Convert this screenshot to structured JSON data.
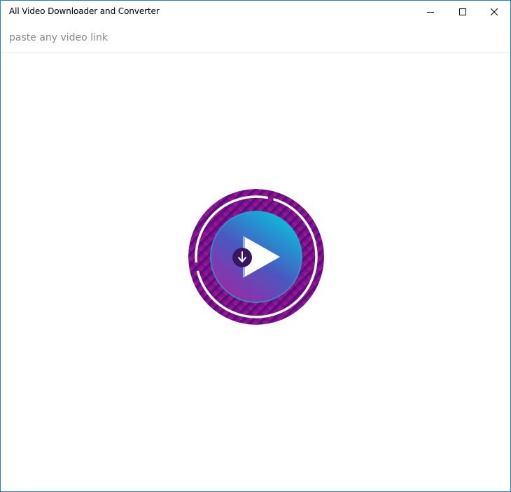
{
  "window": {
    "title": "All Video Downloader and Converter"
  },
  "caption_buttons": {
    "minimize": "minimize-icon",
    "maximize": "maximize-icon",
    "close": "close-icon"
  },
  "url_bar": {
    "placeholder": "paste any video link",
    "value": ""
  },
  "logo": {
    "icon": "play-download-icon",
    "colors": {
      "ring_dark": "#6a0f8e",
      "ring_light": "#b3167f",
      "disc_top": "#10b0d8",
      "disc_bottom": "#8a2aa8",
      "play": "#ffffff",
      "badge": "#3a1660"
    }
  },
  "accent": "#1e7fd6"
}
